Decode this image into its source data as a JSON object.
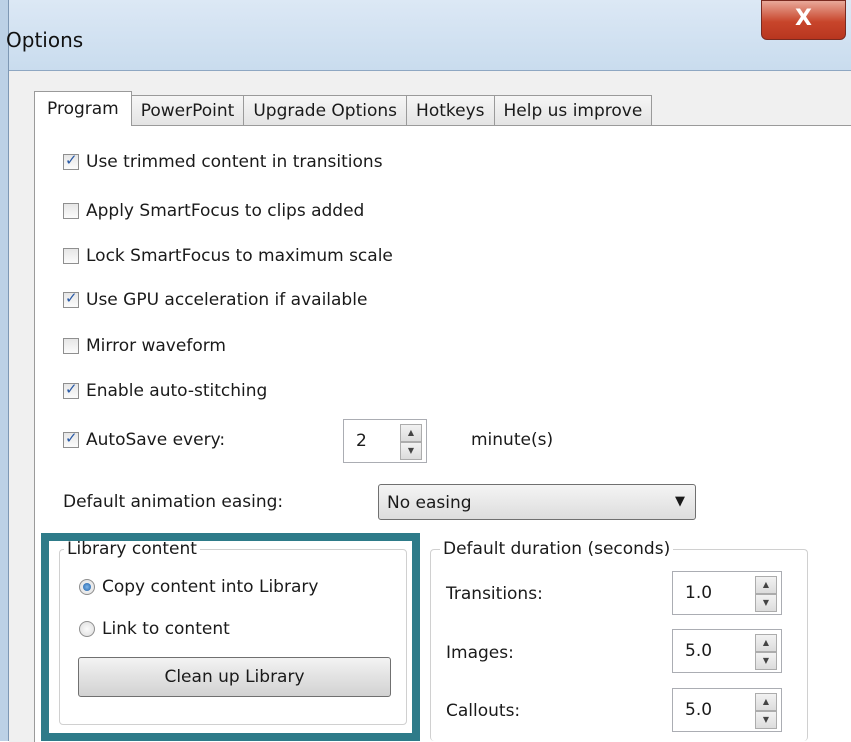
{
  "window": {
    "title": "Options",
    "close_label": "X"
  },
  "tabs": [
    {
      "label": "Program",
      "active": true
    },
    {
      "label": "PowerPoint",
      "active": false
    },
    {
      "label": "Upgrade Options",
      "active": false
    },
    {
      "label": "Hotkeys",
      "active": false
    },
    {
      "label": "Help us improve",
      "active": false
    }
  ],
  "options": [
    {
      "label": "Use trimmed content in transitions",
      "checked": true
    },
    {
      "label": "Apply SmartFocus to clips added",
      "checked": false
    },
    {
      "label": "Lock SmartFocus to maximum scale",
      "checked": false
    },
    {
      "label": "Use GPU acceleration if available",
      "checked": true
    },
    {
      "label": "Mirror waveform",
      "checked": false
    },
    {
      "label": "Enable auto-stitching",
      "checked": true
    }
  ],
  "autosave": {
    "label": "AutoSave every:",
    "checked": true,
    "value": "2",
    "unit": "minute(s)"
  },
  "easing": {
    "label": "Default animation easing:",
    "selected": "No easing"
  },
  "library": {
    "legend": "Library content",
    "copy_label": "Copy content into Library",
    "link_label": "Link to content",
    "selected": "copy",
    "cleanup_button": "Clean up Library"
  },
  "durations": {
    "legend": "Default duration (seconds)",
    "rows": [
      {
        "label": "Transitions:",
        "value": "1.0"
      },
      {
        "label": "Images:",
        "value": "5.0"
      },
      {
        "label": "Callouts:",
        "value": "5.0"
      }
    ]
  },
  "colors": {
    "highlight": "#2e7b89",
    "close": "#c8452b"
  },
  "icons": {
    "spin_up": "▲",
    "spin_down": "▼",
    "dropdown": "▼"
  }
}
